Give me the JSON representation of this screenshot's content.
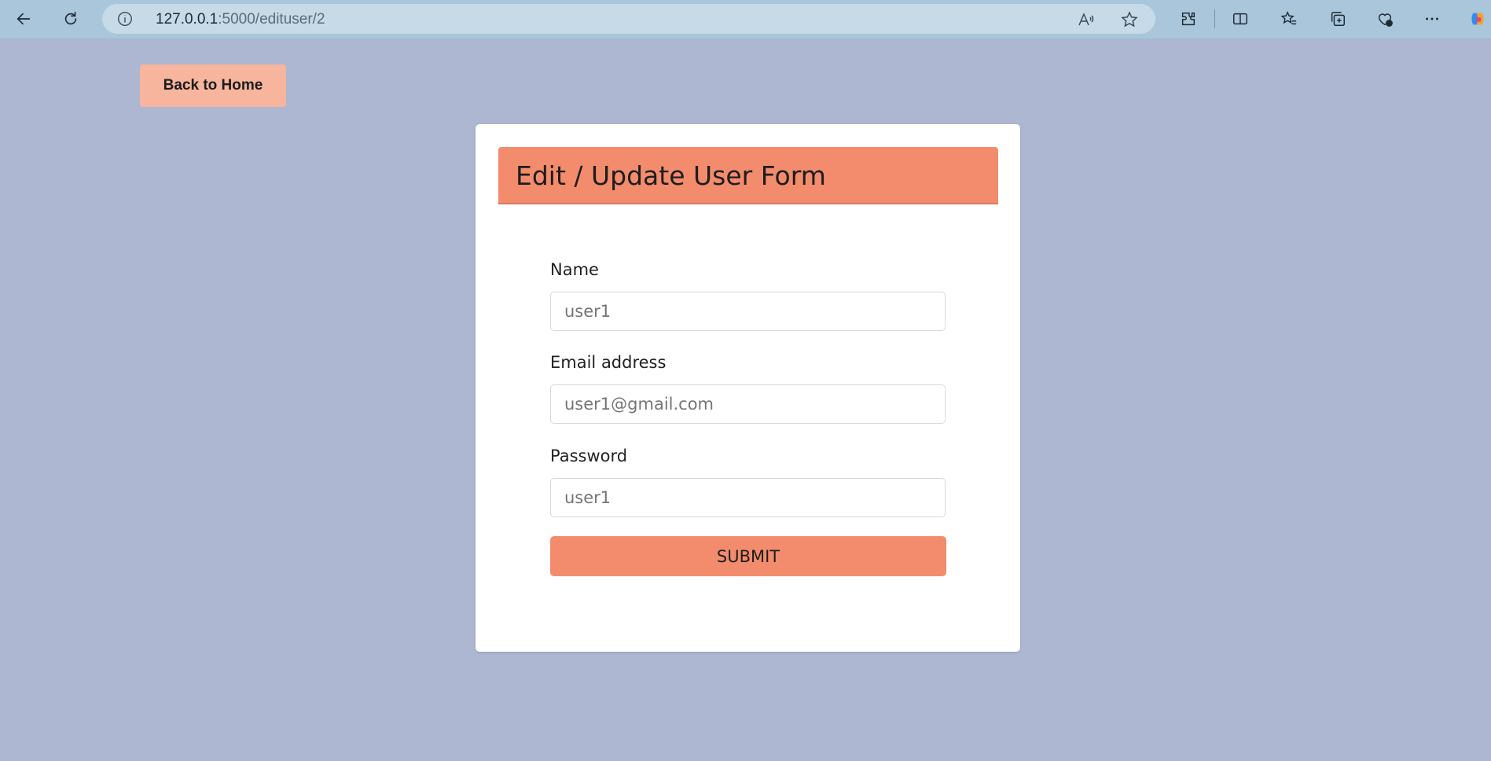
{
  "browser": {
    "url_host": "127.0.0.1",
    "url_path": ":5000/edituser/2",
    "icons": [
      "back-arrow-icon",
      "refresh-icon",
      "info-icon",
      "read-aloud-icon",
      "favorite-star-icon",
      "extensions-icon",
      "split-screen-icon",
      "favorites-icon",
      "collections-icon",
      "browser-essentials-icon",
      "more-icon",
      "copilot-icon"
    ]
  },
  "page": {
    "back_button": "Back to Home",
    "form": {
      "title": "Edit / Update User Form",
      "name_label": "Name",
      "name_value": "user1",
      "email_label": "Email address",
      "email_value": "user1@gmail.com",
      "password_label": "Password",
      "password_value": "user1",
      "submit_label": "SUBMIT"
    }
  },
  "colors": {
    "page_background": "#aeb7d2",
    "accent": "#f38c6c",
    "back_button": "#f6b59c"
  }
}
